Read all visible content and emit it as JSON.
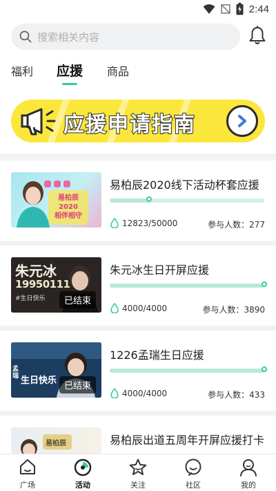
{
  "status_bar": {
    "time": "2:44"
  },
  "search": {
    "placeholder": "搜索相关内容"
  },
  "tabs": [
    {
      "label": "福利",
      "active": false
    },
    {
      "label": "应援",
      "active": true
    },
    {
      "label": "商品",
      "active": false
    }
  ],
  "banner": {
    "text": "应援申请指南"
  },
  "cards": [
    {
      "title": "易柏辰2020线下活动杯套应援",
      "amount": "12823/50000",
      "progress": 0.256,
      "participants": "参与人数：277",
      "thumb_label": "",
      "thumb_art": {
        "lines": [
          "易柏辰",
          "2020",
          "相伴相守"
        ]
      }
    },
    {
      "title": "朱元冰生日开屏应援",
      "amount": "4000/4000",
      "progress": 1.0,
      "participants": "参与人数：3890",
      "thumb_label": "已结束",
      "thumb_art": {
        "lines": [
          "朱元冰",
          "19950111",
          "#生日快乐"
        ]
      }
    },
    {
      "title": "1226孟瑞生日应援",
      "amount": "4000/4000",
      "progress": 1.0,
      "participants": "参与人数：433",
      "thumb_label": "已结束",
      "thumb_art": {
        "lines": [
          "孟瑞",
          "生日快乐"
        ]
      }
    },
    {
      "title": "易柏辰出道五周年开屏应援打卡",
      "thumb_art": {
        "lines": [
          "易柏辰"
        ]
      }
    }
  ],
  "bottom_nav": [
    {
      "label": "广场",
      "icon": "home-icon",
      "active": false
    },
    {
      "label": "活动",
      "icon": "activity-icon",
      "active": true
    },
    {
      "label": "关注",
      "icon": "star-icon",
      "active": false
    },
    {
      "label": "社区",
      "icon": "community-icon",
      "active": false
    },
    {
      "label": "我的",
      "icon": "profile-icon",
      "active": false
    }
  ],
  "colors": {
    "accent": "#39c8a8",
    "banner_yellow": "#fbe63c",
    "progress_track": "#d4f1e8"
  }
}
